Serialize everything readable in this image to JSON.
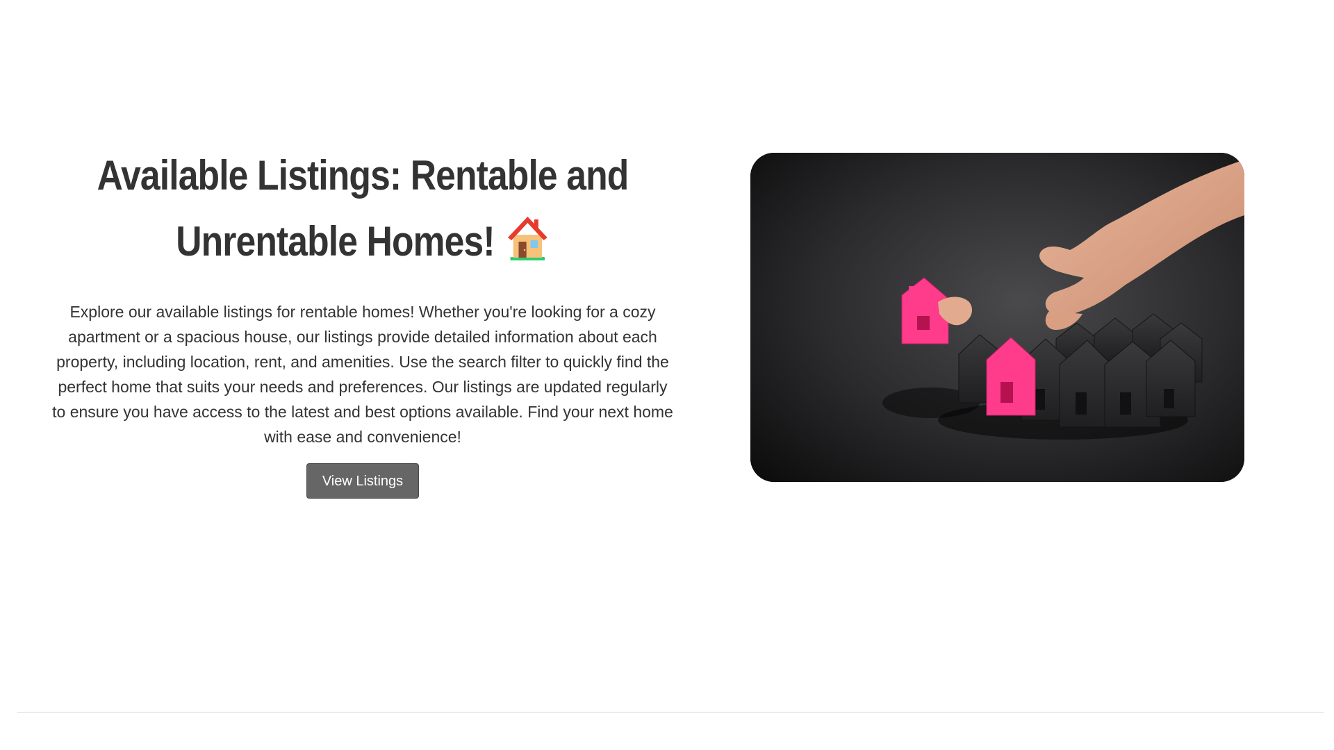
{
  "hero": {
    "title": "Available Listings: Rentable and Unrentable Homes!",
    "title_icon": "house-emoji-icon",
    "description": "Explore our available listings for rentable homes! Whether you're looking for a cozy apartment or a spacious house, our listings provide detailed information about each property, including location, rent, and amenities. Use the search filter to quickly find the perfect home that suits your needs and preferences. Our listings are updated regularly to ensure you have access to the latest and best options available. Find your next home with ease and convenience!",
    "button_label": "View Listings"
  },
  "image": {
    "subject": "hand placing pink model house among dark model houses"
  },
  "colors": {
    "text": "#333333",
    "button_bg": "#666666",
    "button_text": "#ffffff",
    "accent_pink": "#ff3b8b",
    "divider": "#d6d6d6"
  }
}
